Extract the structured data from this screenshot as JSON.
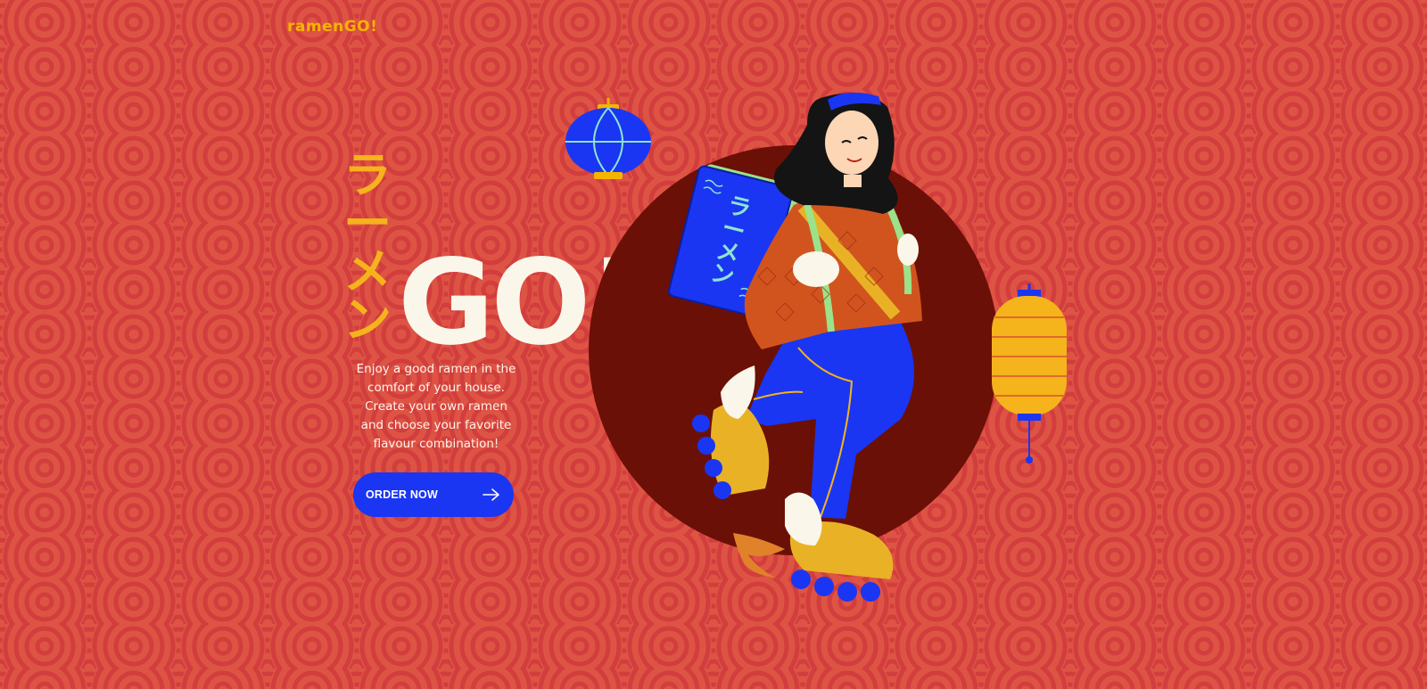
{
  "brand": {
    "logo": "ramenGO!"
  },
  "hero": {
    "katakana": [
      "ラ",
      "ー",
      "メ",
      "ン"
    ],
    "headline": "GO!",
    "tagline_lines": [
      "Enjoy a good ramen in the",
      "comfort of your house.",
      "Create your own ramen",
      "and choose your favorite",
      "flavour combination!"
    ],
    "cta_label": "ORDER NOW",
    "cta_icon": "arrow-right-icon"
  },
  "illustration": {
    "sign_text": [
      "ラ",
      "ー",
      "メ",
      "ン"
    ]
  },
  "colors": {
    "background": "#de5444",
    "pattern": "#d6403e",
    "accent_yellow": "#f5b400",
    "headline": "#fbf6ea",
    "button": "#1a36f2",
    "circle": "#6b1006"
  }
}
